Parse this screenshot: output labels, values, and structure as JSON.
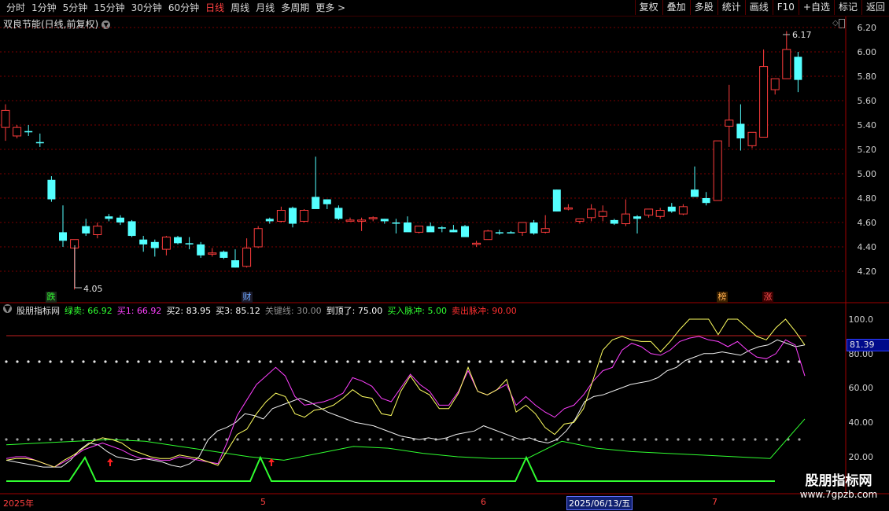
{
  "toolbar": {
    "periods": [
      "分时",
      "1分钟",
      "5分钟",
      "15分钟",
      "30分钟",
      "60分钟",
      "日线",
      "周线",
      "月线",
      "多周期",
      "更多 >"
    ],
    "active_period": "日线",
    "buttons": [
      "复权",
      "叠加",
      "多股",
      "统计",
      "画线",
      "F10",
      "+自选",
      "标记",
      "返回"
    ]
  },
  "stock": {
    "title": "双良节能(日线,前复权)",
    "high_annot": "6.17",
    "low_annot": "4.05"
  },
  "price_axis": [
    "6.20",
    "6.00",
    "5.80",
    "5.60",
    "5.40",
    "5.20",
    "5.00",
    "4.80",
    "4.60",
    "4.40",
    "4.20"
  ],
  "markers": [
    {
      "text": "跌",
      "color": "#30ff30",
      "bg": "#202020"
    },
    {
      "text": "财",
      "color": "#6fa8ff",
      "bg": "#202020"
    },
    {
      "text": "榜",
      "color": "#ffa040",
      "bg": "#402000"
    },
    {
      "text": "涨",
      "color": "#ff4040",
      "bg": "#400000"
    }
  ],
  "indicator": {
    "name": "股朋指标网",
    "items": [
      {
        "label": "绿卖:",
        "value": "66.92",
        "color": "#30ff30"
      },
      {
        "label": "买1:",
        "value": "66.92",
        "color": "#ff40ff"
      },
      {
        "label": "买2:",
        "value": "83.95",
        "color": "#ffffff"
      },
      {
        "label": "买3:",
        "value": "85.12",
        "color": "#ffffff"
      },
      {
        "label": "关键线:",
        "value": "30.00",
        "color": "#909090"
      },
      {
        "label": "到顶了:",
        "value": "75.00",
        "color": "#ffffff"
      },
      {
        "label": "买入脉冲:",
        "value": "5.00",
        "color": "#30ff30"
      },
      {
        "label": "卖出脉冲:",
        "value": "90.00",
        "color": "#ff3030"
      }
    ],
    "axis": [
      "100.0",
      "80.00",
      "60.00",
      "40.00",
      "20.00"
    ],
    "current": "81.39"
  },
  "dates": {
    "labels": [
      "2025年",
      "5",
      "6",
      "7"
    ],
    "selected": "2025/06/13/五"
  },
  "watermark": {
    "title": "股朋指标网",
    "url": "www.7gpzb.com"
  },
  "colors": {
    "up": "#ff3c3c",
    "down": "#54ffff",
    "grid": "#8a0000"
  }
}
